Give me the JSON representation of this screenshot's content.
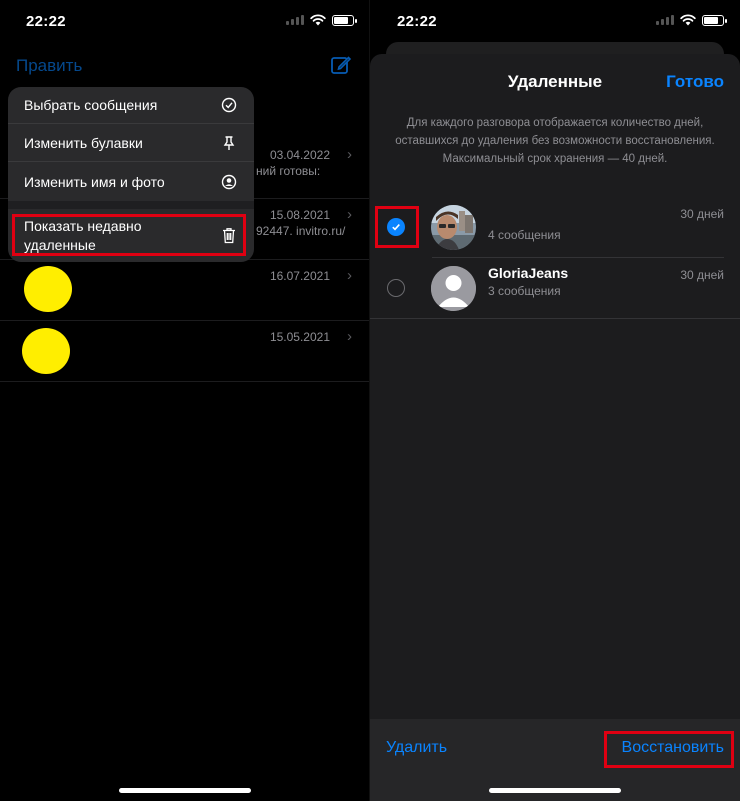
{
  "left": {
    "status": {
      "time": "22:22"
    },
    "edit_label": "Править",
    "context_menu": {
      "items": [
        {
          "label": "Выбрать сообщения",
          "icon": "checkmark-circle-icon"
        },
        {
          "label": "Изменить булавки",
          "icon": "pin-icon"
        },
        {
          "label": "Изменить имя и фото",
          "icon": "person-circle-icon"
        },
        {
          "label": "Показать недавно удаленные",
          "icon": "trash-icon"
        }
      ]
    },
    "rows": [
      {
        "date": "03.04.2022",
        "preview": "ний готовы:"
      },
      {
        "date": "15.08.2021",
        "preview": "92447. invitro.ru/"
      },
      {
        "date": "16.07.2021",
        "preview": ""
      },
      {
        "date": "15.05.2021",
        "preview": ""
      }
    ]
  },
  "right": {
    "status": {
      "time": "22:22"
    },
    "title": "Удаленные",
    "done_label": "Готово",
    "info_text": "Для каждого разговора отображается количество дней, оставшихся до удаления без возможности восстановления. Максимальный срок хранения — 40 дней.",
    "conversations": [
      {
        "name": "",
        "subtitle": "4 сообщения",
        "days": "30 дней",
        "selected": true
      },
      {
        "name": "GloriaJeans",
        "subtitle": "3 сообщения",
        "days": "30 дней",
        "selected": false
      }
    ],
    "toolbar": {
      "delete_label": "Удалить",
      "restore_label": "Восстановить"
    }
  },
  "colors": {
    "accent": "#0a84ff",
    "highlight": "#e00012",
    "yellow": "#ffee00"
  }
}
